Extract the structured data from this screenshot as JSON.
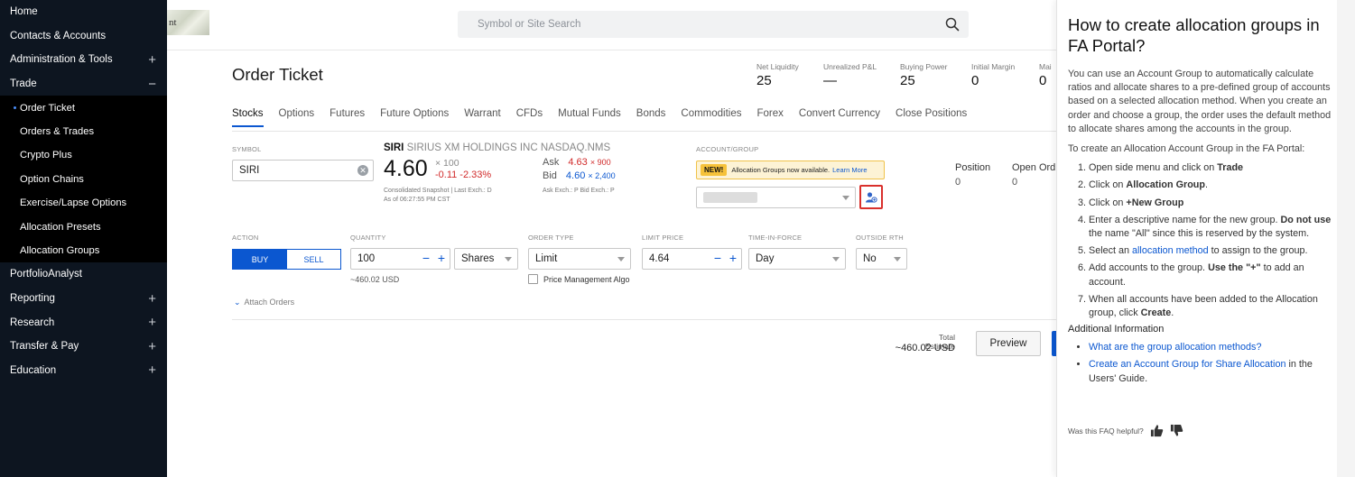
{
  "sidebar": {
    "items": [
      {
        "label": "Home",
        "expand": ""
      },
      {
        "label": "Contacts & Accounts",
        "expand": ""
      },
      {
        "label": "Administration & Tools",
        "expand": "+"
      },
      {
        "label": "Trade",
        "expand": "−"
      }
    ],
    "trade_sub": [
      "Order Ticket",
      "Orders & Trades",
      "Crypto Plus",
      "Option Chains",
      "Exercise/Lapse Options",
      "Allocation Presets",
      "Allocation Groups"
    ],
    "items_after": [
      {
        "label": "PortfolioAnalyst",
        "expand": ""
      },
      {
        "label": "Reporting",
        "expand": "+"
      },
      {
        "label": "Research",
        "expand": "+"
      },
      {
        "label": "Transfer & Pay",
        "expand": "+"
      },
      {
        "label": "Education",
        "expand": "+"
      }
    ]
  },
  "topbar": {
    "logo_text": "nt",
    "search_placeholder": "Symbol or Site Search"
  },
  "main": {
    "title": "Order Ticket",
    "stats": [
      {
        "label": "Net Liquidity",
        "value": "25"
      },
      {
        "label": "Unrealized P&L",
        "value": "—"
      },
      {
        "label": "Buying Power",
        "value": "25"
      },
      {
        "label": "Initial Margin",
        "value": "0"
      },
      {
        "label": "Mai",
        "value": "0"
      }
    ],
    "tabs": [
      "Stocks",
      "Options",
      "Futures",
      "Future Options",
      "Warrant",
      "CFDs",
      "Mutual Funds",
      "Bonds",
      "Commodities",
      "Forex",
      "Convert Currency",
      "Close Positions"
    ],
    "symbol": {
      "label": "SYMBOL",
      "value": "SIRI"
    },
    "quote": {
      "ticker": "SIRI",
      "name": "SIRIUS XM HOLDINGS INC NASDAQ.NMS",
      "last": "4.60",
      "size": "× 100",
      "change": "-0.11 -2.33%",
      "ask_label": "Ask",
      "ask_price": "4.63",
      "ask_size": "× 900",
      "bid_label": "Bid",
      "bid_price": "4.60",
      "bid_size": "× 2,400",
      "snapshot": "Consolidated Snapshot | Last Exch.: D",
      "asof": "As of 06:27:55 PM CST",
      "exch": "Ask Exch.: P Bid Exch.: P"
    },
    "account": {
      "label": "ACCOUNT/GROUP",
      "new_badge": "NEW!",
      "banner_text": "Allocation Groups now available.",
      "banner_link": "Learn More"
    },
    "position": {
      "label": "Position",
      "value": "0"
    },
    "open_orders": {
      "label": "Open Ord",
      "value": "0"
    },
    "action": {
      "label": "ACTION",
      "buy": "BUY",
      "sell": "SELL"
    },
    "quantity": {
      "label": "QUANTITY",
      "value": "100",
      "unit": "Shares",
      "approx": "~460.02 USD"
    },
    "order_type": {
      "label": "ORDER TYPE",
      "value": "Limit",
      "pma": "Price Management Algo"
    },
    "limit_price": {
      "label": "LIMIT PRICE",
      "value": "4.64"
    },
    "tif": {
      "label": "TIME-IN-FORCE",
      "value": "Day"
    },
    "rth": {
      "label": "OUTSIDE RTH",
      "value": "No"
    },
    "attach_orders": "Attach Orders",
    "total_label": "Total Estimate",
    "total_value": "~460.02 USD",
    "preview": "Preview"
  },
  "faq": {
    "title": "How to create allocation groups in FA Portal?",
    "intro": "You can use an Account Group to automatically calculate ratios and allocate shares to a pre-defined group of accounts based on a selected allocation method. When you create an order and choose a group, the order uses the default method to allocate shares among the accounts in the group.",
    "lead": "To create an Allocation Account Group in the FA Portal:",
    "step1_pre": "Open side menu and click on ",
    "step1_b": "Trade",
    "step2_pre": "Click on ",
    "step2_b": "Allocation Group",
    "step2_post": ".",
    "step3_pre": "Click on ",
    "step3_b": "+New Group",
    "step4_pre": "Enter a descriptive name for the new group. ",
    "step4_b": "Do not use",
    "step4_post": " the name \"All\" since this is reserved by the system.",
    "step5_pre": "Select an ",
    "step5_link": "allocation method",
    "step5_post": " to assign to the group.",
    "step6_pre": "Add accounts to the group. ",
    "step6_b": "Use the \"+\"",
    "step6_post": " to add an account.",
    "step7_pre": "When all accounts have been added to the Allocation group, click ",
    "step7_b": "Create",
    "step7_post": ".",
    "additional": "Additional Information",
    "link1": "What are the group allocation methods?",
    "link2": "Create an Account Group for Share Allocation",
    "link2_post": " in the Users' Guide.",
    "helpful": "Was this FAQ helpful?"
  },
  "colors": {
    "accent": "#0b57d0",
    "negative": "#d12a2a",
    "sidebar": "#0d1520"
  }
}
